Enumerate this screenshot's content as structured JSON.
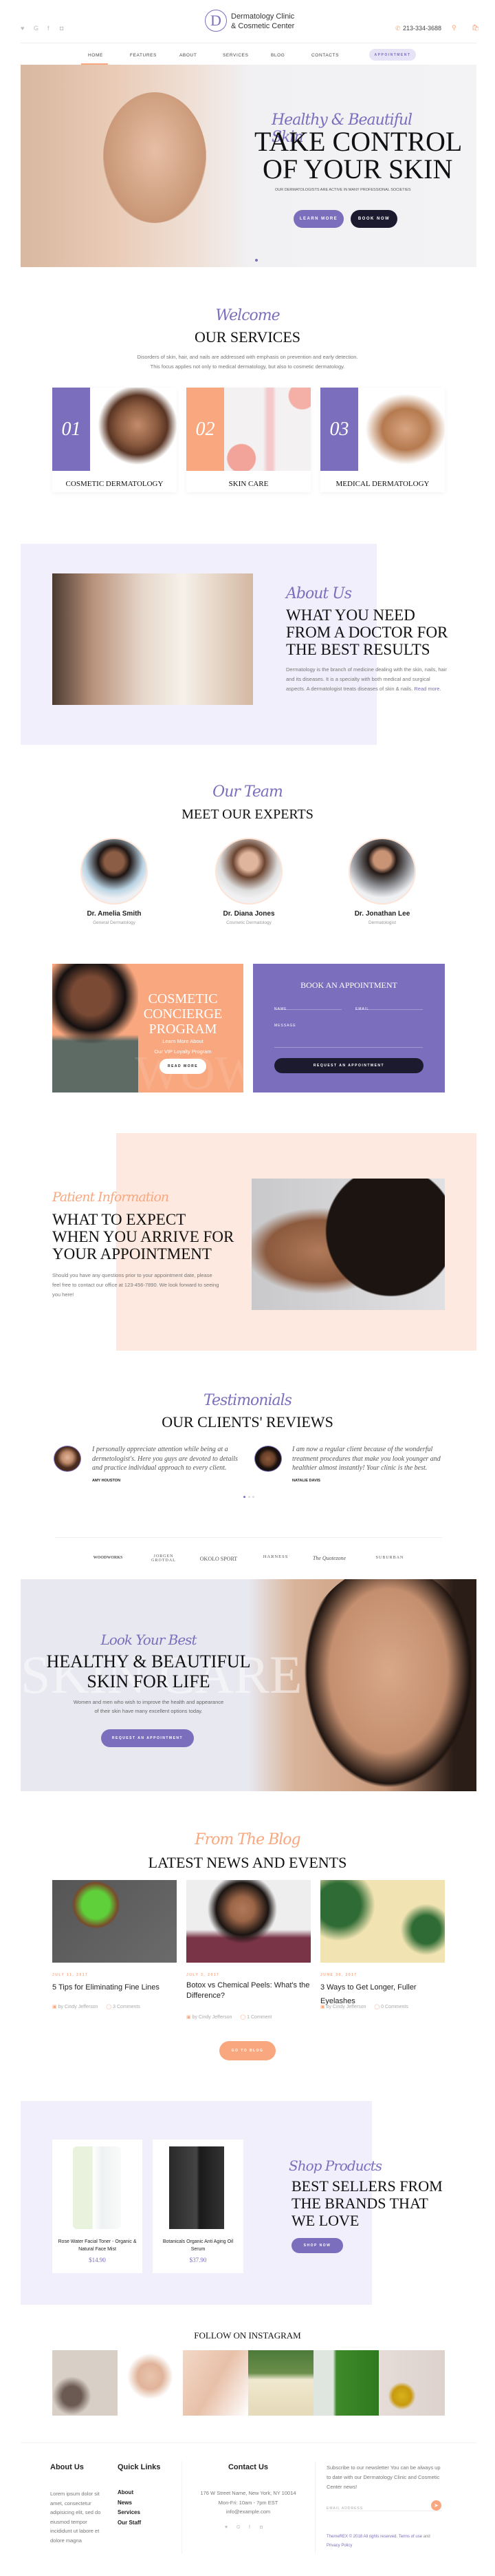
{
  "header": {
    "logo_letter": "D",
    "logo_line1": "Dermatology Clinic",
    "logo_line2": "& Cosmetic Center",
    "social": [
      "twitter-icon",
      "google-icon",
      "facebook-icon",
      "instagram-icon"
    ],
    "phone": "213-334-3688",
    "nav": [
      "HOME",
      "FEATURES",
      "ABOUT",
      "SERVICES",
      "BLOG",
      "CONTACTS"
    ],
    "active_nav": "HOME",
    "appointment": "APPOINTMENT"
  },
  "hero": {
    "script": "Healthy & Beautiful Skin",
    "title1": "TAKE CONTROL",
    "title2": "OF YOUR SKIN",
    "subtitle": "OUR DERMATOLOGISTS ARE ACTIVE IN MANY PROFESSIONAL SOCIETIES",
    "learn_more": "LEARN MORE",
    "book_now": "BOOK NOW"
  },
  "services": {
    "script": "Welcome",
    "title": "OUR SERVICES",
    "line1": "Disorders of skin, hair, and nails are addressed with emphasis on prevention and early detection.",
    "line2": "This focus applies not only to medical dermatology, but also to cosmetic dermatology.",
    "items": [
      {
        "num": "01",
        "title": "COSMETIC DERMATOLOGY"
      },
      {
        "num": "02",
        "title": "SKIN CARE"
      },
      {
        "num": "03",
        "title": "MEDICAL DERMATOLOGY"
      }
    ]
  },
  "about": {
    "script": "About Us",
    "title1": "WHAT YOU NEED",
    "title2": "FROM A DOCTOR FOR",
    "title3": "THE BEST RESULTS",
    "text": "Dermatology is the branch of medicine dealing with the skin, nails, hair and its diseases. It is a specialty with both medical and surgical aspects. A dermatologist treats diseases of skin & nails.",
    "read_more": "Read more."
  },
  "team": {
    "script": "Our Team",
    "title": "MEET OUR EXPERTS",
    "members": [
      {
        "name": "Dr. Amelia Smith",
        "role": "General Dermatology"
      },
      {
        "name": "Dr. Diana Jones",
        "role": "Cosmetic Dermatology"
      },
      {
        "name": "Dr. Jonathan Lee",
        "role": "Dermatologist"
      }
    ]
  },
  "promo": {
    "title1": "COSMETIC",
    "title2": "CONCIERGE",
    "title3": "PROGRAM",
    "sub1": "Learn More About",
    "sub2": "Our VIP Loyalty Program",
    "watermark": "WOW",
    "button": "READ MORE"
  },
  "booking": {
    "title": "BOOK AN APPOINTMENT",
    "name_label": "NAME",
    "email_label": "EMAIL",
    "message_label": "MESSAGE",
    "button": "REQUEST AN APPOINTMENT"
  },
  "patient": {
    "script": "Patient Information",
    "title1": "WHAT TO EXPECT",
    "title2": "WHEN YOU ARRIVE FOR",
    "title3": "YOUR APPOINTMENT",
    "text": "Should you have any questions prior to your appointment date, please feel free to contact our office at 123-456-7890. We look forward to seeing you here!"
  },
  "testimonials": {
    "script": "Testimonials",
    "title": "OUR CLIENTS' REVIEWS",
    "items": [
      {
        "quote": "I personally appreciate attention while being at a dermetologist's. Here you guys are devoted to details and practice individual approach to every client.",
        "name": "AMY HOUSTON"
      },
      {
        "quote": "I am now a regular client because of the wonderful treatment procedures that make you look younger and healthier almost instantly! Your clinic is the best.",
        "name": "NATALIE DAVIS"
      }
    ]
  },
  "brands": [
    "WOODWORKS",
    "JORGEN GROTDAL",
    "OKOLO SPORT",
    "HARNESS",
    "The Quotezone",
    "SUBURBAN"
  ],
  "banner": {
    "script": "Look Your Best",
    "title1": "HEALTHY & BEAUTIFUL",
    "title2": "SKIN FOR LIFE",
    "watermark": "SKIN CARE",
    "text1": "Women and men who wish to improve the health and appearance",
    "text2": "of their skin have many excellent options today.",
    "button": "REQUEST AN APPOINTMENT"
  },
  "blog": {
    "script": "From The Blog",
    "title": "LATEST NEWS AND EVENTS",
    "posts": [
      {
        "date": "JULY 11, 2017",
        "title": "5 Tips for Eliminating Fine Lines",
        "author": "by Cindy Jefferson",
        "comments": "3 Comments"
      },
      {
        "date": "JULY 3, 2017",
        "title": "Botox vs Chemical Peels: What's the Difference?",
        "author": "by Cindy Jefferson",
        "comments": "1 Comment"
      },
      {
        "date": "JUNE 30, 2017",
        "title": "3 Ways to Get Longer, Fuller Eyelashes",
        "author": "by Cindy Jefferson",
        "comments": "0 Comments"
      }
    ],
    "button": "GO TO BLOG"
  },
  "shop": {
    "script": "Shop Products",
    "title1": "BEST SELLERS FROM",
    "title2": "THE BRANDS THAT",
    "title3": "WE LOVE",
    "button": "SHOP NOW",
    "products": [
      {
        "name": "Rose Water Facial Toner - Organic & Natural Face Mist",
        "price": "$14.90"
      },
      {
        "name": "Botanicals Organic Anti Aging Oil Serum",
        "price": "$37.90"
      }
    ]
  },
  "instagram": {
    "title": "FOLLOW ON INSTAGRAM"
  },
  "footer": {
    "about_title": "About Us",
    "about_text": "Lorem ipsum dolor sit amet, consectetur adipisicing elit, sed do eiusmod tempor incididunt ut labore et dolore magna",
    "links_title": "Quick Links",
    "links": [
      "About",
      "News",
      "Services",
      "Our Staff"
    ],
    "contact_title": "Contact Us",
    "address": "176 W Street Name, New York, NY 10014",
    "hours": "Mon-Fri: 10am - 7pm EST",
    "email": "info@example.com",
    "newsletter": "Subscribe to our newsletter You can be always up to date with our Dermatology Clinic and Cosmetic Center news!",
    "email_placeholder": "EMAIL ADDRESS",
    "copyright": "ThemeREX © 2018 All rights reserved.",
    "terms": "Terms of use",
    "and": "and",
    "privacy": "Privacy Policy"
  },
  "colors": {
    "accent": "#7b6fbd",
    "peach": "#f9a77e",
    "lavender_bg": "#f0effb",
    "peach_bg": "#fde9df",
    "dark": "#1c1a2e"
  }
}
